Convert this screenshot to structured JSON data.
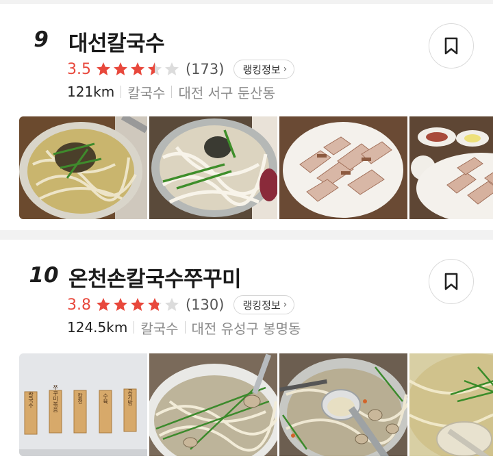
{
  "restaurants": [
    {
      "rank": "9",
      "name": "대선칼국수",
      "score": "3.5",
      "stars": 3.5,
      "review_count": "(173)",
      "ranking_label": "랭킹정보",
      "distance": "121km",
      "category": "칼국수",
      "address": "대전 서구 둔산동",
      "photos": [
        "noodle-soup-photo",
        "noodle-soup-photo",
        "boiled-pork-photo",
        "boiled-pork-photo"
      ]
    },
    {
      "rank": "10",
      "name": "온천손칼국수쭈꾸미",
      "score": "3.8",
      "stars": 3.8,
      "review_count": "(130)",
      "ranking_label": "랭킹정보",
      "distance": "124.5km",
      "category": "칼국수",
      "address": "대전 유성구 봉명동",
      "photos": [
        "menu-board-photo",
        "clam-noodle-photo",
        "clam-noodle-ladle-photo",
        "noodle-soup-photo"
      ]
    }
  ],
  "menu_boards": [
    "칼국수",
    "쭈꾸미볶음",
    "칼전",
    "수육",
    "공기밥"
  ],
  "colors": {
    "accent": "#e8483c",
    "star_empty": "#dcdcdc",
    "muted_text": "#8a8a8a",
    "divider": "#f2f2f2"
  },
  "icons": {
    "bookmark": "bookmark-icon",
    "chevron": "chevron-right-icon",
    "star": "star-icon"
  }
}
